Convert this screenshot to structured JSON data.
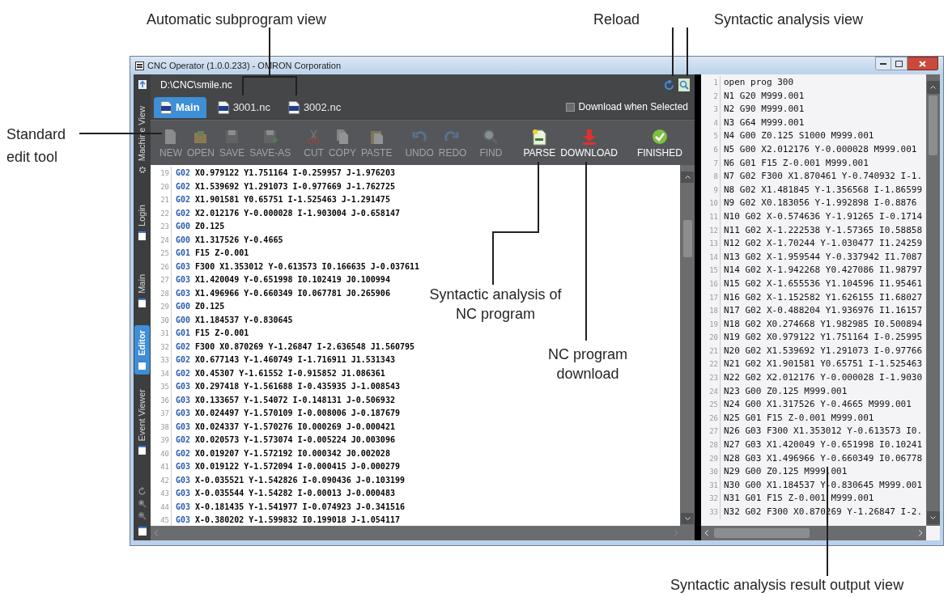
{
  "window": {
    "title": "CNC Operator (1.0.0.233) - OMRON Corporation"
  },
  "side_tabs": [
    {
      "label": "Machine View",
      "selected": false
    },
    {
      "label": "Login",
      "selected": false
    },
    {
      "label": "Main",
      "selected": false
    },
    {
      "label": "Editor",
      "selected": true
    },
    {
      "label": "Event Viewer",
      "selected": false
    }
  ],
  "file_path": "D:\\CNC\\smile.nc",
  "program_tabs": [
    {
      "label": "Main",
      "selected": true
    },
    {
      "label": "3001.nc",
      "selected": false
    },
    {
      "label": "3002.nc",
      "selected": false
    }
  ],
  "download_when_selected": {
    "label": "Download when Selected",
    "checked": false
  },
  "toolbar": {
    "groups": [
      {
        "items": [
          {
            "label": "NEW",
            "disabled": true
          },
          {
            "label": "OPEN",
            "disabled": true
          },
          {
            "label": "SAVE",
            "disabled": true
          },
          {
            "label": "SAVE-AS",
            "disabled": true
          }
        ]
      },
      {
        "items": [
          {
            "label": "CUT",
            "disabled": true
          },
          {
            "label": "COPY",
            "disabled": true
          },
          {
            "label": "PASTE",
            "disabled": true
          }
        ]
      },
      {
        "items": [
          {
            "label": "UNDO",
            "disabled": true
          },
          {
            "label": "REDO",
            "disabled": true
          }
        ]
      },
      {
        "items": [
          {
            "label": "FIND",
            "disabled": true
          }
        ]
      },
      {
        "items": [
          {
            "label": "PARSE",
            "disabled": false
          },
          {
            "label": "DOWNLOAD",
            "disabled": false
          }
        ]
      },
      {
        "items": [
          {
            "label": "FINISHED",
            "disabled": false
          }
        ]
      }
    ]
  },
  "editor": {
    "lines": [
      {
        "number": "19",
        "code": "G02",
        "args": "X0.979122 Y1.751164 I-0.259957 J-1.976203"
      },
      {
        "number": "20",
        "code": "G02",
        "args": "X1.539692 Y1.291073 I-0.977669 J-1.762725"
      },
      {
        "number": "21",
        "code": "G02",
        "args": "X1.901581 Y0.65751 I-1.525463 J-1.291475"
      },
      {
        "number": "22",
        "code": "G02",
        "args": "X2.012176 Y-0.000028 I-1.903004 J-0.658147"
      },
      {
        "number": "23",
        "code": "G00",
        "args": "Z0.125"
      },
      {
        "number": "24",
        "code": "G00",
        "args": "X1.317526 Y-0.4665"
      },
      {
        "number": "25",
        "code": "G01",
        "args": "F15 Z-0.001"
      },
      {
        "number": "26",
        "code": "G03",
        "args": "F300 X1.353012 Y-0.613573 I0.166635 J-0.037611"
      },
      {
        "number": "27",
        "code": "G03",
        "args": "X1.420049 Y-0.651998 I0.102419 J0.100994"
      },
      {
        "number": "28",
        "code": "G03",
        "args": "X1.496966 Y-0.660349 I0.067781 J0.265906"
      },
      {
        "number": "29",
        "code": "G00",
        "args": "Z0.125"
      },
      {
        "number": "30",
        "code": "G00",
        "args": "X1.184537 Y-0.830645"
      },
      {
        "number": "31",
        "code": "G01",
        "args": "F15 Z-0.001"
      },
      {
        "number": "32",
        "code": "G02",
        "args": "F300 X0.870269 Y-1.26847 I-2.636548 J1.560795"
      },
      {
        "number": "33",
        "code": "G02",
        "args": "X0.677143 Y-1.460749 I-1.716911 J1.531343"
      },
      {
        "number": "34",
        "code": "G02",
        "args": "X0.45307 Y-1.61552 I-0.915852 J1.086361"
      },
      {
        "number": "35",
        "code": "G03",
        "args": "X0.297418 Y-1.561688 I-0.435935 J-1.008543"
      },
      {
        "number": "36",
        "code": "G03",
        "args": "X0.133657 Y-1.54072 I-0.148131 J-0.506932"
      },
      {
        "number": "37",
        "code": "G03",
        "args": "X0.024497 Y-1.570109 I-0.008006 J-0.187679"
      },
      {
        "number": "38",
        "code": "G03",
        "args": "X0.024337 Y-1.570276 I0.000269 J-0.000421"
      },
      {
        "number": "39",
        "code": "G02",
        "args": "X0.020573 Y-1.573074 I-0.005224 J0.003096"
      },
      {
        "number": "40",
        "code": "G02",
        "args": "X0.019207 Y-1.572192 I0.000342 J0.002028"
      },
      {
        "number": "41",
        "code": "G03",
        "args": "X0.019122 Y-1.572094 I-0.000415 J-0.000279"
      },
      {
        "number": "42",
        "code": "G03",
        "args": "X-0.035521 Y-1.542826 I-0.090436 J-0.103199"
      },
      {
        "number": "43",
        "code": "G03",
        "args": "X-0.035544 Y-1.54282 I-0.00013 J-0.000483"
      },
      {
        "number": "44",
        "code": "G03",
        "args": "X-0.181435 Y-1.541977 I-0.074923 J-0.341516"
      },
      {
        "number": "45",
        "code": "G03",
        "args": "X-0.380202 Y-1.599832 I0.199018 J-1.054117"
      }
    ]
  },
  "output": {
    "lines": [
      {
        "number": "1",
        "text": "open prog 300"
      },
      {
        "number": "2",
        "text": "N1 G20 M999.001"
      },
      {
        "number": "3",
        "text": "N2 G90 M999.001"
      },
      {
        "number": "4",
        "text": "N3 G64 M999.001"
      },
      {
        "number": "5",
        "text": "N4 G00 Z0.125 S1000 M999.001"
      },
      {
        "number": "6",
        "text": "N5 G00 X2.012176 Y-0.000028 M999.001"
      },
      {
        "number": "7",
        "text": "N6 G01 F15 Z-0.001 M999.001"
      },
      {
        "number": "8",
        "text": "N7 G02 F300 X1.870461 Y-0.740932 I-1."
      },
      {
        "number": "9",
        "text": "N8 G02 X1.481845 Y-1.356568 I-1.86599"
      },
      {
        "number": "10",
        "text": "N9 G02 X0.183056 Y-1.992898 I-0.8876"
      },
      {
        "number": "11",
        "text": "N10 G02 X-0.574636 Y-1.91265 I-0.1714"
      },
      {
        "number": "12",
        "text": "N11 G02 X-1.222538 Y-1.57365 I0.58858"
      },
      {
        "number": "13",
        "text": "N12 G02 X-1.70244 Y-1.030477 I1.24259"
      },
      {
        "number": "14",
        "text": "N13 G02 X-1.959544 Y-0.337942 I1.7087"
      },
      {
        "number": "15",
        "text": "N14 G02 X-1.942268 Y0.427086 I1.98797"
      },
      {
        "number": "16",
        "text": "N15 G02 X-1.655536 Y1.104596 I1.95461"
      },
      {
        "number": "17",
        "text": "N16 G02 X-1.152582 Y1.626155 I1.68027"
      },
      {
        "number": "18",
        "text": "N17 G02 X-0.488204 Y1.936976 I1.16157"
      },
      {
        "number": "19",
        "text": "N18 G02 X0.274668 Y1.982985 I0.500894"
      },
      {
        "number": "20",
        "text": "N19 G02 X0.979122 Y1.751164 I-0.25995"
      },
      {
        "number": "21",
        "text": "N20 G02 X1.539692 Y1.291073 I-0.97766"
      },
      {
        "number": "22",
        "text": "N21 G02 X1.901581 Y0.65751 I-1.525463"
      },
      {
        "number": "23",
        "text": "N22 G02 X2.012176 Y-0.000028 I-1.9030"
      },
      {
        "number": "24",
        "text": "N23 G00 Z0.125 M999.001"
      },
      {
        "number": "25",
        "text": "N24 G00 X1.317526 Y-0.4665 M999.001"
      },
      {
        "number": "26",
        "text": "N25 G01 F15 Z-0.001 M999.001"
      },
      {
        "number": "27",
        "text": "N26 G03 F300 X1.353012 Y-0.613573 I0."
      },
      {
        "number": "28",
        "text": "N27 G03 X1.420049 Y-0.651998 I0.10241"
      },
      {
        "number": "29",
        "text": "N28 G03 X1.496966 Y-0.660349 I0.06778"
      },
      {
        "number": "30",
        "text": "N29 G00 Z0.125 M999.001"
      },
      {
        "number": "31",
        "text": "N30 G00 X1.184537 Y-0.830645 M999.001"
      },
      {
        "number": "32",
        "text": "N31 G01 F15 Z-0.001 M999.001"
      },
      {
        "number": "33",
        "text": "N32 G02 F300 X0.870269 Y-1.26847 I-2."
      }
    ]
  },
  "callouts": [
    {
      "text": "Automatic subprogram view"
    },
    {
      "text": "Reload"
    },
    {
      "text": "Syntactic analysis view"
    },
    {
      "text": "Standard edit tool"
    },
    {
      "text": "Syntactic analysis of NC program"
    },
    {
      "text": "NC program download"
    },
    {
      "text": "Syntactic analysis result output view"
    }
  ]
}
